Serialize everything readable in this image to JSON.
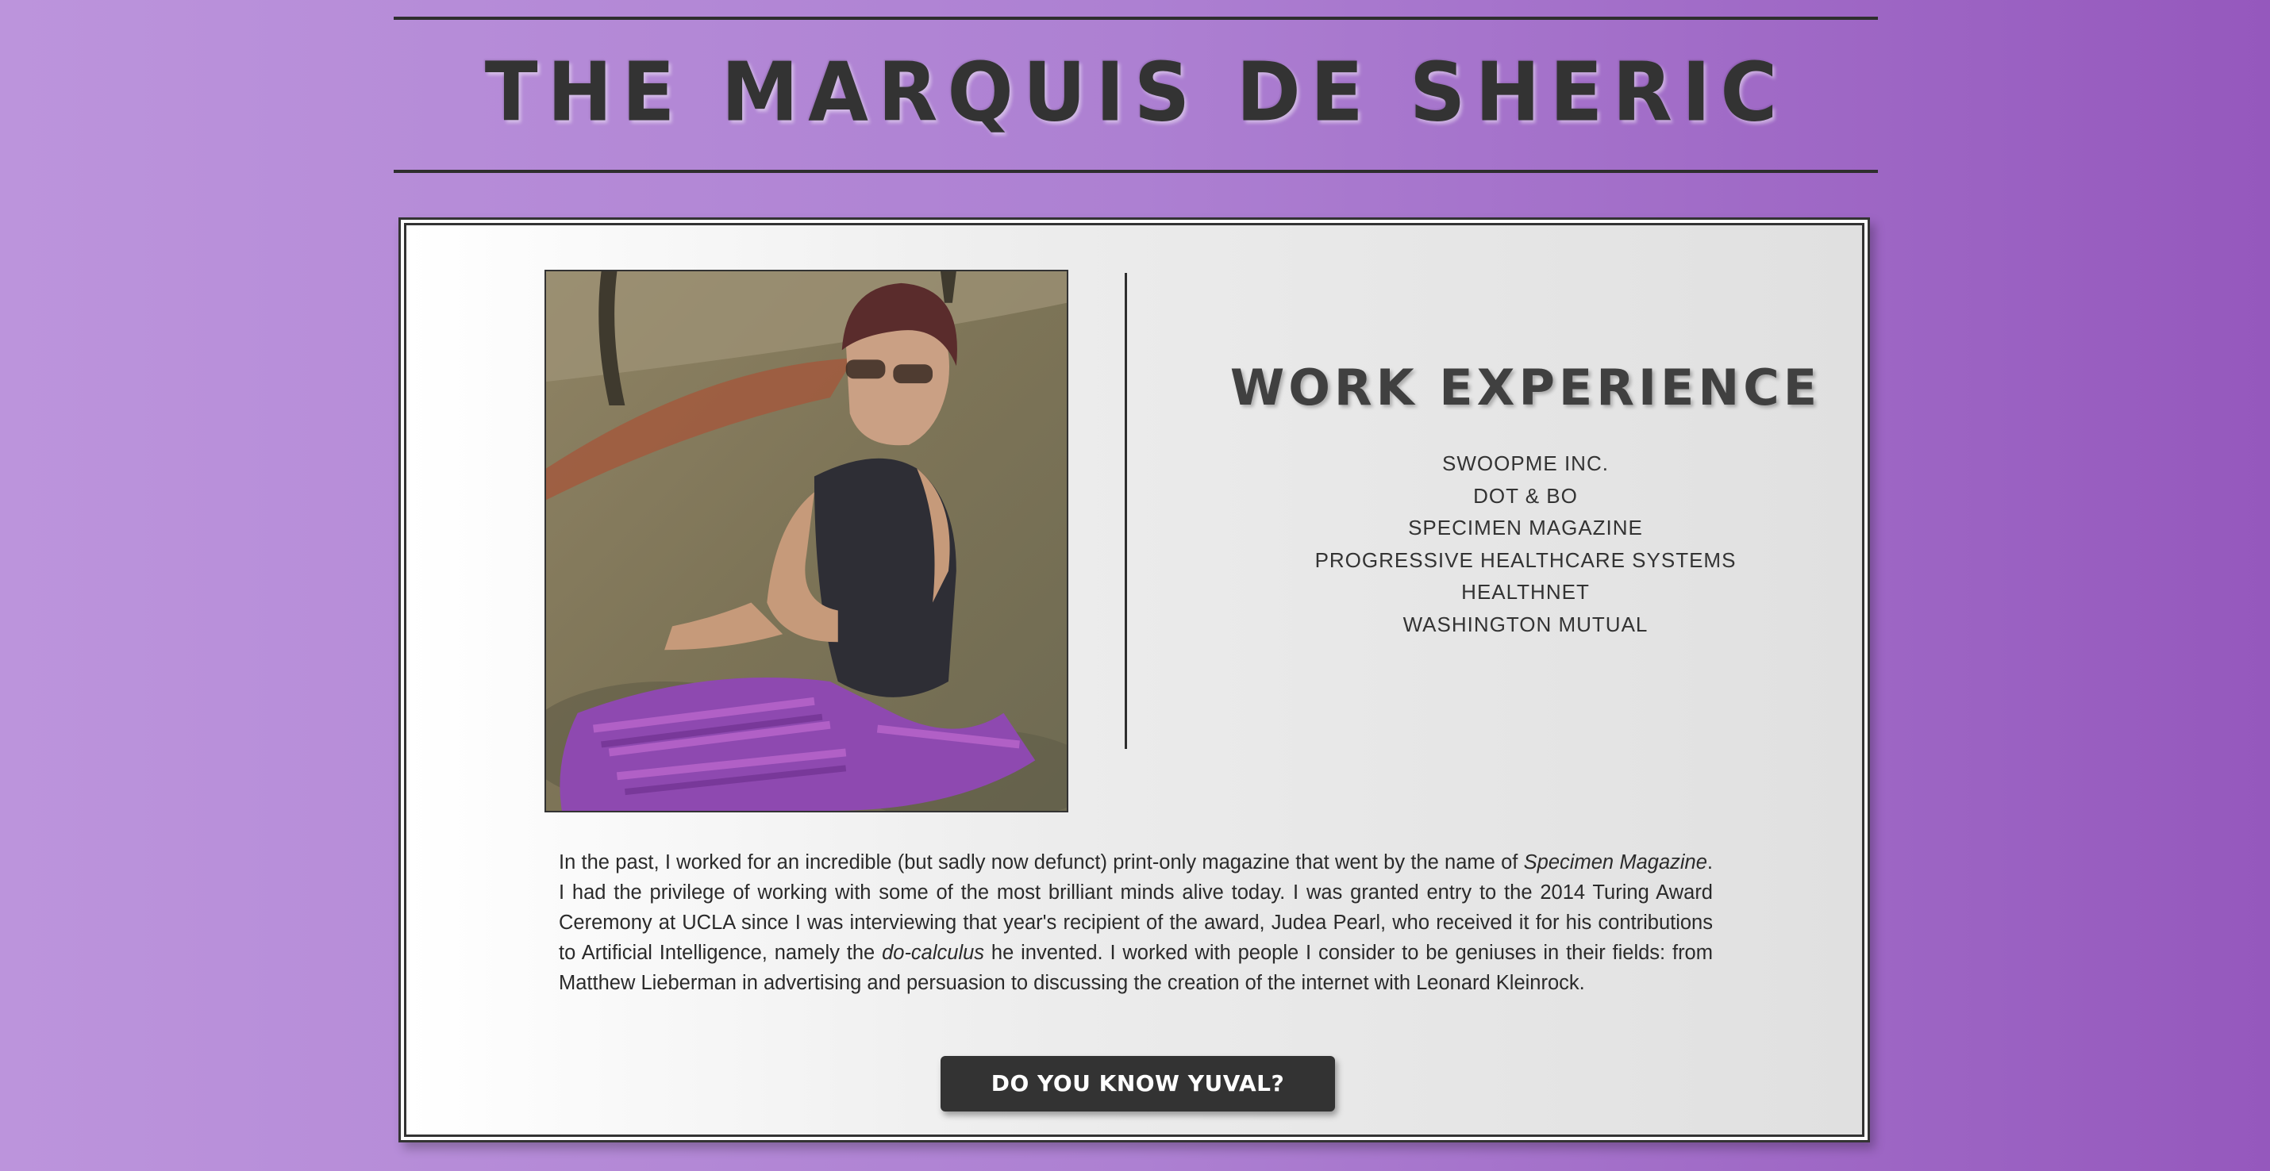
{
  "header": {
    "title": "THE MARQUIS DE SHERIC"
  },
  "work": {
    "heading": "WORK EXPERIENCE",
    "items": [
      "SWOOPME INC.",
      "DOT & BO",
      "SPECIMEN MAGAZINE",
      "PROGRESSIVE HEALTHCARE SYSTEMS",
      "HEALTHNET",
      "WASHINGTON MUTUAL"
    ]
  },
  "bio": {
    "part1": "In the past, I worked for an incredible (but sadly now defunct) print-only magazine that went by the name of ",
    "em1": "Specimen Magazine",
    "part2": ". I had the privilege of working with some of the most brilliant minds alive today. I was granted entry to the 2014 Turing Award Ceremony at UCLA since I was interviewing that year's recipient of the award, Judea Pearl, who received it for his contributions to Artificial Intelligence, namely the ",
    "em2": "do-calculus",
    "part3": " he invented. I worked with people I consider to be geniuses in their fields: from Matthew Lieberman in advertising and persuasion to discussing the creation of the internet with Leonard Kleinrock."
  },
  "cta": {
    "label": "DO YOU KNOW YUVAL?"
  },
  "colors": {
    "background_start": "#bc94dc",
    "background_end": "#9558bd",
    "text_dark": "#333333",
    "button_bg": "#333333",
    "button_text": "#ffffff"
  }
}
